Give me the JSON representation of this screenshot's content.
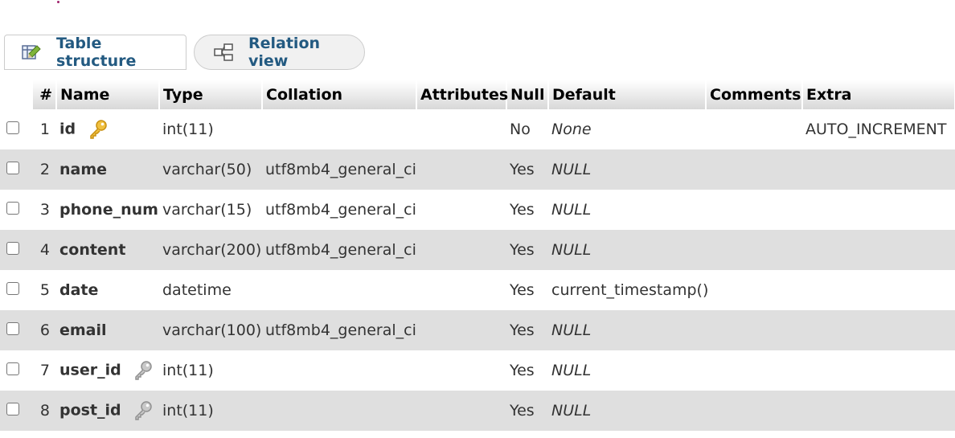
{
  "tabs": [
    {
      "label": "Table structure",
      "icon": "table-structure-icon"
    },
    {
      "label": "Relation view",
      "icon": "relation-view-icon"
    }
  ],
  "columns": {
    "num": "#",
    "name": "Name",
    "type": "Type",
    "collation": "Collation",
    "attributes": "Attributes",
    "null": "Null",
    "default": "Default",
    "comments": "Comments",
    "extra": "Extra"
  },
  "rows": [
    {
      "num": "1",
      "name": "id",
      "key": "primary-key-icon",
      "type": "int(11)",
      "collation": "",
      "attributes": "",
      "null": "No",
      "default": "None",
      "comments": "",
      "extra": "AUTO_INCREMENT"
    },
    {
      "num": "2",
      "name": "name",
      "key": "",
      "type": "varchar(50)",
      "collation": "utf8mb4_general_ci",
      "attributes": "",
      "null": "Yes",
      "default": "NULL",
      "comments": "",
      "extra": ""
    },
    {
      "num": "3",
      "name": "phone_num",
      "key": "",
      "type": "varchar(15)",
      "collation": "utf8mb4_general_ci",
      "attributes": "",
      "null": "Yes",
      "default": "NULL",
      "comments": "",
      "extra": ""
    },
    {
      "num": "4",
      "name": "content",
      "key": "",
      "type": "varchar(200)",
      "collation": "utf8mb4_general_ci",
      "attributes": "",
      "null": "Yes",
      "default": "NULL",
      "comments": "",
      "extra": ""
    },
    {
      "num": "5",
      "name": "date",
      "key": "",
      "type": "datetime",
      "collation": "",
      "attributes": "",
      "null": "Yes",
      "default": "current_timestamp()",
      "comments": "",
      "extra": ""
    },
    {
      "num": "6",
      "name": "email",
      "key": "",
      "type": "varchar(100)",
      "collation": "utf8mb4_general_ci",
      "attributes": "",
      "null": "Yes",
      "default": "NULL",
      "comments": "",
      "extra": ""
    },
    {
      "num": "7",
      "name": "user_id",
      "key": "index-key-icon",
      "type": "int(11)",
      "collation": "",
      "attributes": "",
      "null": "Yes",
      "default": "NULL",
      "comments": "",
      "extra": ""
    },
    {
      "num": "8",
      "name": "post_id",
      "key": "index-key-icon",
      "type": "int(11)",
      "collation": "",
      "attributes": "",
      "null": "Yes",
      "default": "NULL",
      "comments": "",
      "extra": ""
    }
  ],
  "colors": {
    "tab_text": "#235a81",
    "row_alt": "#dfdfdf",
    "primary_key": "#e0b020",
    "index_key": "#a0a0a0"
  }
}
